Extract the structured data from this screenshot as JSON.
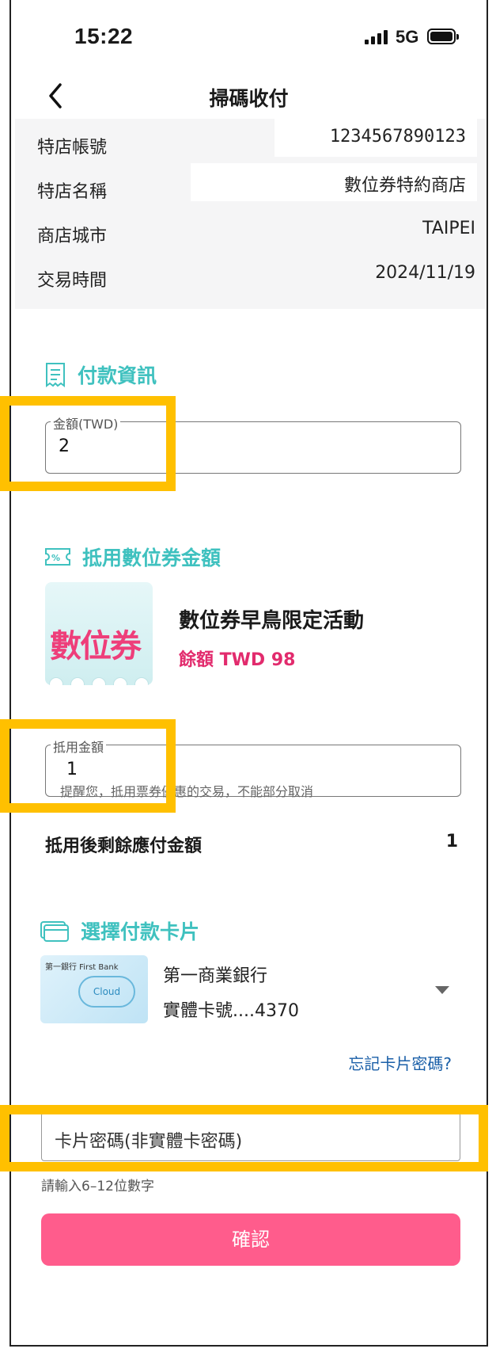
{
  "status": {
    "time": "15:22",
    "network": "5G"
  },
  "nav": {
    "title": "掃碼收付"
  },
  "merchant": {
    "rows": [
      {
        "label": "特店帳號",
        "value": "1234567890123"
      },
      {
        "label": "特店名稱",
        "value": "數位券特約商店"
      },
      {
        "label": "商店城市",
        "value": "TAIPEI"
      },
      {
        "label": "交易時間",
        "value": "2024/11/19"
      }
    ]
  },
  "payment": {
    "heading": "付款資訊",
    "amount_label": "金額(TWD)",
    "amount_value": "2"
  },
  "voucher": {
    "heading": "抵用數位券金額",
    "coupon_image_text": "數位券",
    "coupon_title": "數位券早鳥限定活動",
    "balance": "餘額 TWD 98",
    "deduct_label": "抵用金額",
    "deduct_value": "1",
    "hint": "提醒您，抵用票券優惠的交易，不能部分取消",
    "remaining_label": "抵用後剩餘應付金額",
    "remaining_value": "1"
  },
  "card": {
    "heading": "選擇付款卡片",
    "brand_text": "第一銀行 First Bank",
    "cloud_text": "Cloud",
    "bank_name": "第一商業銀行",
    "card_number": "實體卡號....4370",
    "forgot_link": "忘記卡片密碼?",
    "password_placeholder": "卡片密碼(非實體卡密碼)",
    "password_hint": "請輸入6–12位數字"
  },
  "actions": {
    "confirm": "確認"
  },
  "colors": {
    "accent": "#3fc1bf",
    "primary_button": "#ff5c8c",
    "highlight": "#ffc000",
    "balance": "#e22b6d",
    "link": "#1a5fa8"
  },
  "icons": [
    "back-chevron-icon",
    "receipt-icon",
    "coupon-ticket-icon",
    "credit-card-icon",
    "dropdown-triangle-icon",
    "signal-icon",
    "battery-icon"
  ]
}
